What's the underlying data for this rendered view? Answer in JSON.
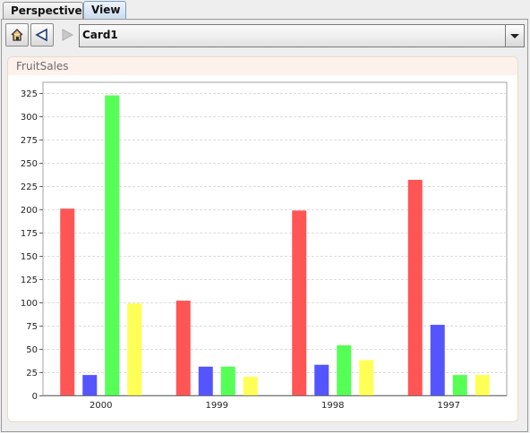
{
  "tabs": [
    {
      "label": "Perspective"
    },
    {
      "label": "View"
    }
  ],
  "toolbar": {
    "combo_value": "Card1"
  },
  "card": {
    "title": "FruitSales"
  },
  "chart_data": {
    "type": "bar",
    "categories": [
      "2000",
      "1999",
      "1998",
      "1997"
    ],
    "series": [
      {
        "color": "#ff5555",
        "values": [
          201,
          102,
          199,
          232
        ]
      },
      {
        "color": "#5555ff",
        "values": [
          22,
          31,
          33,
          76
        ]
      },
      {
        "color": "#55ff55",
        "values": [
          323,
          31,
          54,
          22
        ]
      },
      {
        "color": "#ffff55",
        "values": [
          99,
          20,
          38,
          22
        ]
      }
    ],
    "ylim": [
      0,
      337
    ],
    "yticks": [
      0,
      25,
      50,
      75,
      100,
      125,
      150,
      175,
      200,
      225,
      250,
      275,
      300,
      325
    ],
    "grid": true,
    "legend": "none"
  }
}
